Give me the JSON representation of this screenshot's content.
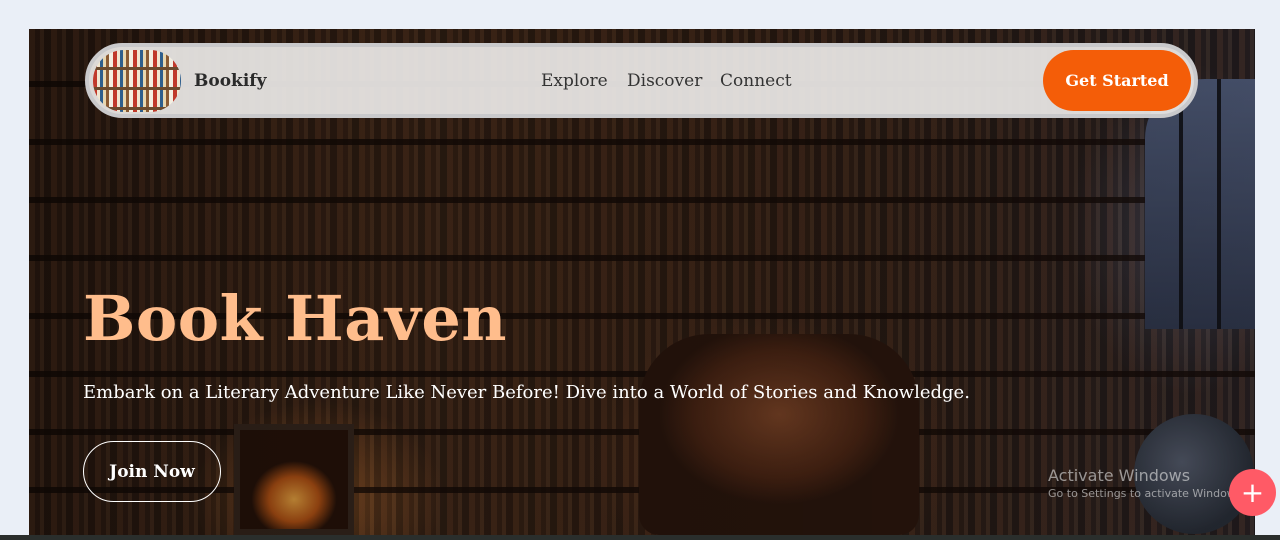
{
  "nav": {
    "brand": "Bookify",
    "links": [
      "Explore",
      "Discover",
      "Connect"
    ],
    "cta_label": "Get Started"
  },
  "hero": {
    "title": "Book Haven",
    "subtitle": "Embark on a Literary Adventure Like Never Before! Dive into a World of Stories and Knowledge.",
    "join_label": "Join Now"
  },
  "watermark": {
    "title": "Activate Windows",
    "subtitle": "Go to Settings to activate Windows."
  },
  "fab": {
    "icon": "plus-icon",
    "glyph": "+"
  },
  "colors": {
    "accent": "#f45d08",
    "title": "#ffbd8c",
    "fab": "#ff5a66",
    "page_bg": "#eaeff7"
  }
}
